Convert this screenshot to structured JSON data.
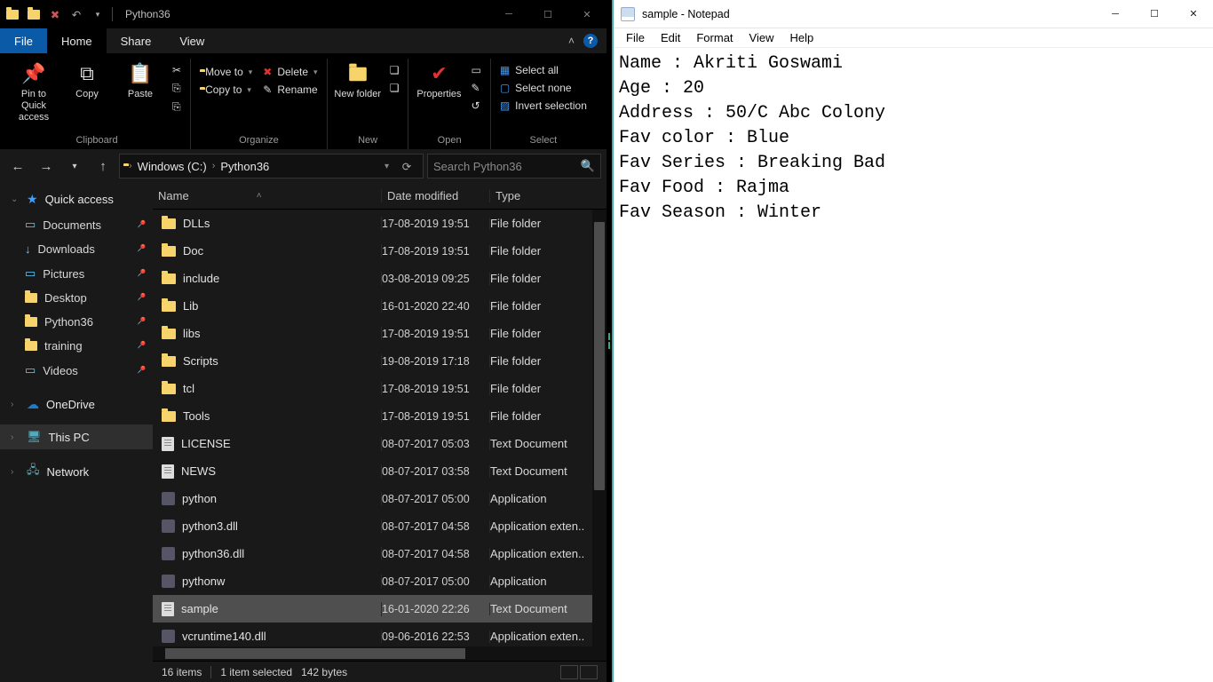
{
  "explorer": {
    "title": "Python36",
    "tabs": {
      "file": "File",
      "home": "Home",
      "share": "Share",
      "view": "View"
    },
    "ribbon": {
      "clipboard": {
        "label": "Clipboard",
        "pin": "Pin to Quick access",
        "copy": "Copy",
        "paste": "Paste"
      },
      "organize": {
        "label": "Organize",
        "move": "Move to",
        "copyto": "Copy to",
        "delete": "Delete",
        "rename": "Rename"
      },
      "new": {
        "label": "New",
        "newfolder": "New folder"
      },
      "open": {
        "label": "Open",
        "properties": "Properties"
      },
      "select": {
        "label": "Select",
        "all": "Select all",
        "none": "Select none",
        "invert": "Invert selection"
      }
    },
    "breadcrumbs": {
      "drive": "Windows (C:)",
      "folder": "Python36"
    },
    "search_placeholder": "Search Python36",
    "nav": {
      "quick_access": "Quick access",
      "items": [
        {
          "label": "Documents",
          "icon": "doc"
        },
        {
          "label": "Downloads",
          "icon": "down"
        },
        {
          "label": "Pictures",
          "icon": "pic"
        },
        {
          "label": "Desktop",
          "icon": "folder"
        },
        {
          "label": "Python36",
          "icon": "folder"
        },
        {
          "label": "training",
          "icon": "folder"
        },
        {
          "label": "Videos",
          "icon": "vid"
        }
      ],
      "onedrive": "OneDrive",
      "thispc": "This PC",
      "network": "Network"
    },
    "columns": {
      "name": "Name",
      "date": "Date modified",
      "type": "Type"
    },
    "files": [
      {
        "name": "DLLs",
        "date": "17-08-2019 19:51",
        "type": "File folder",
        "kind": "folder"
      },
      {
        "name": "Doc",
        "date": "17-08-2019 19:51",
        "type": "File folder",
        "kind": "folder"
      },
      {
        "name": "include",
        "date": "03-08-2019 09:25",
        "type": "File folder",
        "kind": "folder"
      },
      {
        "name": "Lib",
        "date": "16-01-2020 22:40",
        "type": "File folder",
        "kind": "folder"
      },
      {
        "name": "libs",
        "date": "17-08-2019 19:51",
        "type": "File folder",
        "kind": "folder"
      },
      {
        "name": "Scripts",
        "date": "19-08-2019 17:18",
        "type": "File folder",
        "kind": "folder"
      },
      {
        "name": "tcl",
        "date": "17-08-2019 19:51",
        "type": "File folder",
        "kind": "folder"
      },
      {
        "name": "Tools",
        "date": "17-08-2019 19:51",
        "type": "File folder",
        "kind": "folder"
      },
      {
        "name": "LICENSE",
        "date": "08-07-2017 05:03",
        "type": "Text Document",
        "kind": "file"
      },
      {
        "name": "NEWS",
        "date": "08-07-2017 03:58",
        "type": "Text Document",
        "kind": "file"
      },
      {
        "name": "python",
        "date": "08-07-2017 05:00",
        "type": "Application",
        "kind": "exe"
      },
      {
        "name": "python3.dll",
        "date": "08-07-2017 04:58",
        "type": "Application exten..",
        "kind": "exe"
      },
      {
        "name": "python36.dll",
        "date": "08-07-2017 04:58",
        "type": "Application exten..",
        "kind": "exe"
      },
      {
        "name": "pythonw",
        "date": "08-07-2017 05:00",
        "type": "Application",
        "kind": "exe"
      },
      {
        "name": "sample",
        "date": "16-01-2020 22:26",
        "type": "Text Document",
        "kind": "file",
        "selected": true
      },
      {
        "name": "vcruntime140.dll",
        "date": "09-06-2016 22:53",
        "type": "Application exten..",
        "kind": "exe"
      }
    ],
    "status": {
      "count": "16 items",
      "selected": "1 item selected",
      "size": "142 bytes"
    }
  },
  "notepad": {
    "title": "sample - Notepad",
    "menu": {
      "file": "File",
      "edit": "Edit",
      "format": "Format",
      "view": "View",
      "help": "Help"
    },
    "content": "Name : Akriti Goswami\nAge : 20\nAddress : 50/C Abc Colony\nFav color : Blue\nFav Series : Breaking Bad\nFav Food : Rajma\nFav Season : Winter"
  }
}
